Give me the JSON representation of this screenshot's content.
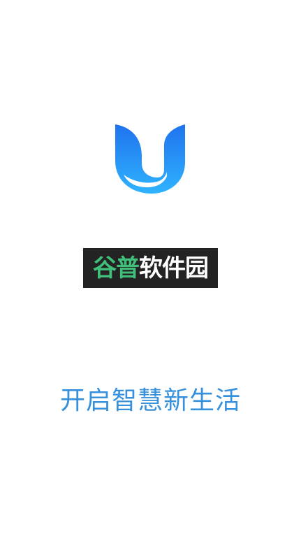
{
  "splash": {
    "logo_icon": "stylized-u-logo-icon",
    "logo_colors": {
      "top": "#1f7df0",
      "bottom": "#2fb0ff",
      "cutout": "#ffffff"
    },
    "watermark": {
      "part1": "谷普",
      "part2": "软件园"
    },
    "slogan": "开启智慧新生活",
    "slogan_color": "#3690db"
  }
}
